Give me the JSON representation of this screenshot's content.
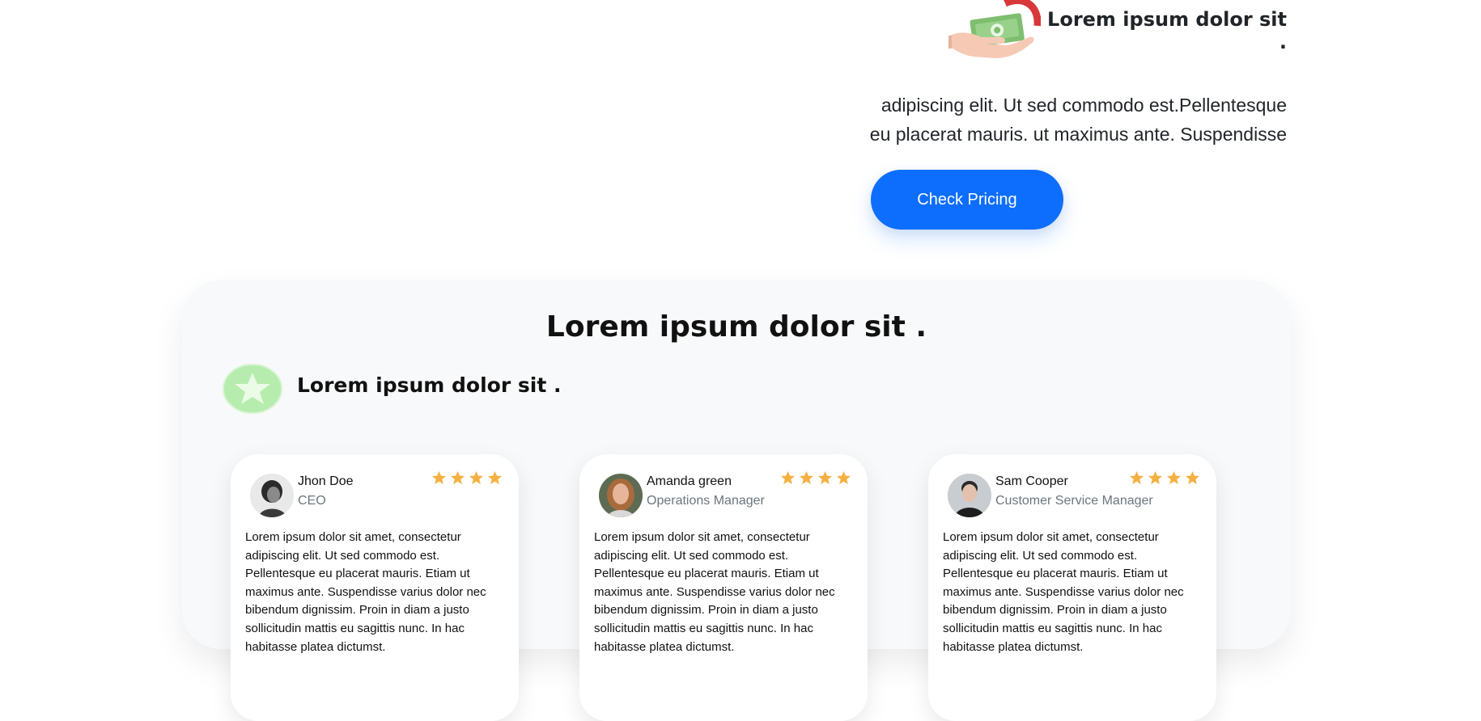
{
  "top": {
    "heading": "Lorem ipsum dolor sit .",
    "desc_line1": "adipiscing elit. Ut sed commodo est.Pellentesque",
    "desc_line2": "eu placerat mauris. ut maximus ante. Suspendisse",
    "button_label": "Check Pricing",
    "icon": "money-hand-icon"
  },
  "testimonials": {
    "title": "Lorem ipsum dolor sit .",
    "subtitle": "Lorem ipsum dolor sit .",
    "badge_icon": "star-badge-icon",
    "cards": [
      {
        "name": "Jhon Doe",
        "role": "CEO",
        "rating": 4,
        "text": "Lorem ipsum dolor sit amet, consectetur adipiscing elit. Ut sed commodo est. Pellentesque eu placerat mauris. Etiam ut maximus ante. Suspendisse varius dolor nec bibendum dignissim. Proin in diam a justo sollicitudin mattis eu sagittis nunc. In hac habitasse platea dictumst."
      },
      {
        "name": "Amanda green",
        "role": "Operations Manager",
        "rating": 4,
        "text": "Lorem ipsum dolor sit amet, consectetur adipiscing elit. Ut sed commodo est. Pellentesque eu placerat mauris. Etiam ut maximus ante. Suspendisse varius dolor nec bibendum dignissim. Proin in diam a justo sollicitudin mattis eu sagittis nunc. In hac habitasse platea dictumst."
      },
      {
        "name": "Sam Cooper",
        "role": "Customer Service Manager",
        "rating": 4,
        "text": "Lorem ipsum dolor sit amet, consectetur adipiscing elit. Ut sed commodo est. Pellentesque eu placerat mauris. Etiam ut maximus ante. Suspendisse varius dolor nec bibendum dignissim. Proin in diam a justo sollicitudin mattis eu sagittis nunc. In hac habitasse platea dictumst."
      }
    ]
  },
  "colors": {
    "primary": "#0d6efd",
    "star": "#f5b042",
    "panel_bg": "#f8f9fa",
    "badge_green": "#b6ecae"
  }
}
